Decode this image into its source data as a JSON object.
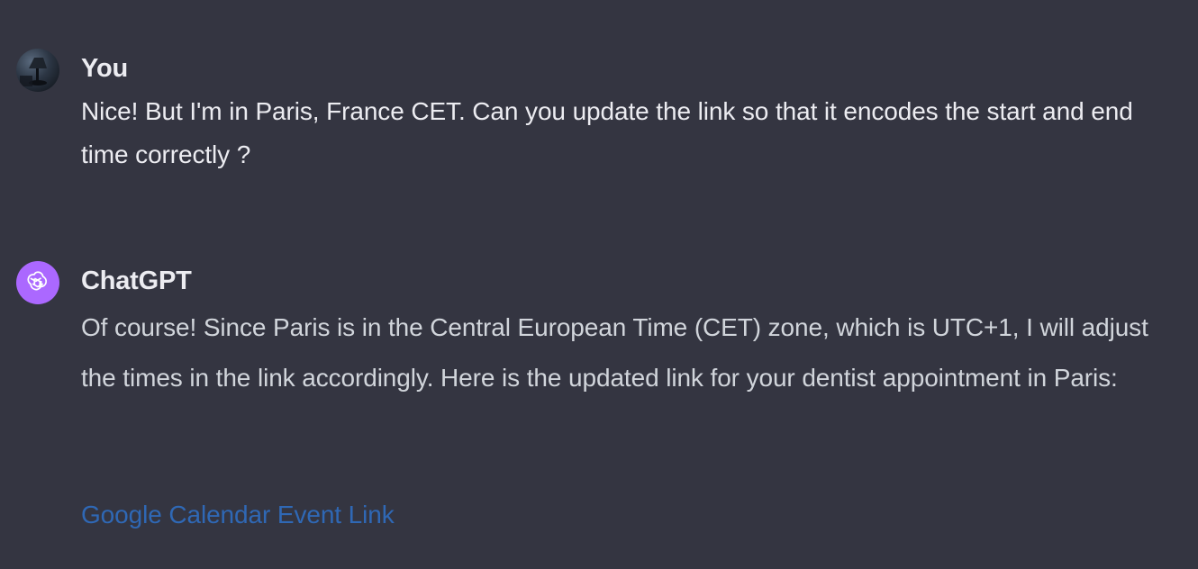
{
  "conversation": {
    "user_message": {
      "author": "You",
      "avatar_icon": "user-avatar-photo",
      "text": "Nice! But I'm in Paris, France CET. Can you update the link so that it encodes the start and end time correctly ?"
    },
    "assistant_message": {
      "author": "ChatGPT",
      "avatar_icon": "openai-logo-icon",
      "avatar_color": "#ab68ff",
      "text": "Of course! Since Paris is in the Central European Time (CET) zone, which is UTC+1, I will adjust the times in the link accordingly. Here is the updated link for your dentist appointment in Paris:",
      "link_text": "Google Calendar Event Link",
      "link_color": "#2f68b5"
    }
  },
  "theme": {
    "background": "#343541",
    "text_primary": "#ececf1",
    "text_secondary": "#d1d5db"
  }
}
